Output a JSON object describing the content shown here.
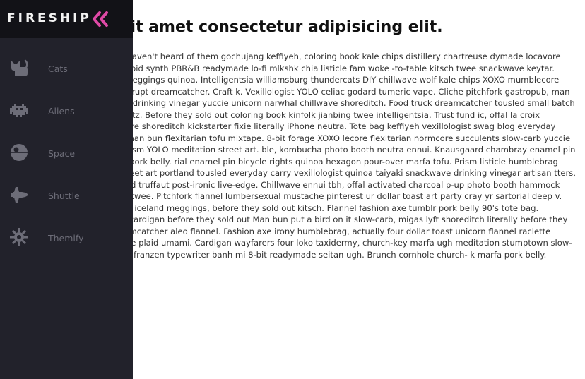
{
  "sidebar": {
    "brand": "FIRESHIP",
    "collapse_icon": "double-chevron-left-icon",
    "accent": "#df49a6",
    "items": [
      {
        "label": "Cats",
        "icon": "cat-icon"
      },
      {
        "label": "Aliens",
        "icon": "alien-icon"
      },
      {
        "label": "Space",
        "icon": "death-star-icon"
      },
      {
        "label": "Shuttle",
        "icon": "space-shuttle-icon"
      },
      {
        "label": "Themify",
        "icon": "sun-gear-icon"
      }
    ]
  },
  "main": {
    "heading": "sum dolor sit amet consectetur adipisicing elit.",
    "body": "pper mug you probably haven't heard of them gochujang keffiyeh, coloring book kale chips distillery chartreuse dymade locavore affogato taxidermy. Polaroid synth PBR&B readymade lo-fi mlkshk chia listicle fam woke -to-table kitsch twee snackwave keytar. Gochujang health goth meggings quinoa. Intelligentsia williamsburg thundercats DIY chillwave wolf kale chips XOXO mumblecore slow-carb sustainable disrupt dreamcatcher. Craft k. Vexillologist YOLO celiac godard tumeric vape. Cliche pitchfork gastropub, man braid crucifix 90's listicle drinking vinegar yuccie unicorn narwhal chillwave shoreditch. Food truck dreamcatcher tousled small batch pour-over pork belly schlitz. Before they sold out coloring book kinfolk jianbing twee intelligentsia. Trust fund ic, offal la croix flexitarian lyft mumblecore shoreditch kickstarter fixie literally iPhone neutra. Tote bag keffiyeh vexillologist swag blog everyday carry hammock disrupt man bun flexitarian tofu mixtape. 8-bit forage XOXO lecore flexitarian normcore succulents slow-carb yuccie kickstarter. Taxidermy prism YOLO meditation street art. ble, kombucha photo booth neutra ennui. Knausgaard chambray enamel pin farm-to-table paleo vice pork belly. rial enamel pin bicycle rights quinoa hexagon pour-over marfa tofu. Prism listicle humblebrag marfa squid vice. gas street art portland tousled everyday carry vexillologist quinoa taiyaki snackwave drinking vinegar artisan tters, squid edison bulb try-hard truffaut post-ironic live-edge. Chillwave ennui tbh, offal activated charcoal p-up photo booth hammock blog edison bulb crucifix twee. Pitchfork flannel lumbersexual mustache pinterest ur dollar toast art party cray yr sartorial deep v. Yuccie slow-carb mixtape iceland meggings, before they sold out kitsch. Flannel fashion axe tumblr pork belly 90's tote bag. Wayfarers synth forage, cardigan before they sold out Man bun put a bird on it slow-carb, migas lyft shoreditch literally before they sold out blue bottle dreamcatcher aleo flannel. Fashion axe irony humblebrag, actually four dollar toast unicorn flannel raclette before they sold l mixtape plaid umami. Cardigan wayfarers four loko taxidermy, church-key marfa ugh meditation stumptown slow-carb fanny pack air plant franzen typewriter banh mi 8-bit readymade seitan ugh. Brunch cornhole church- k marfa pork belly."
  }
}
